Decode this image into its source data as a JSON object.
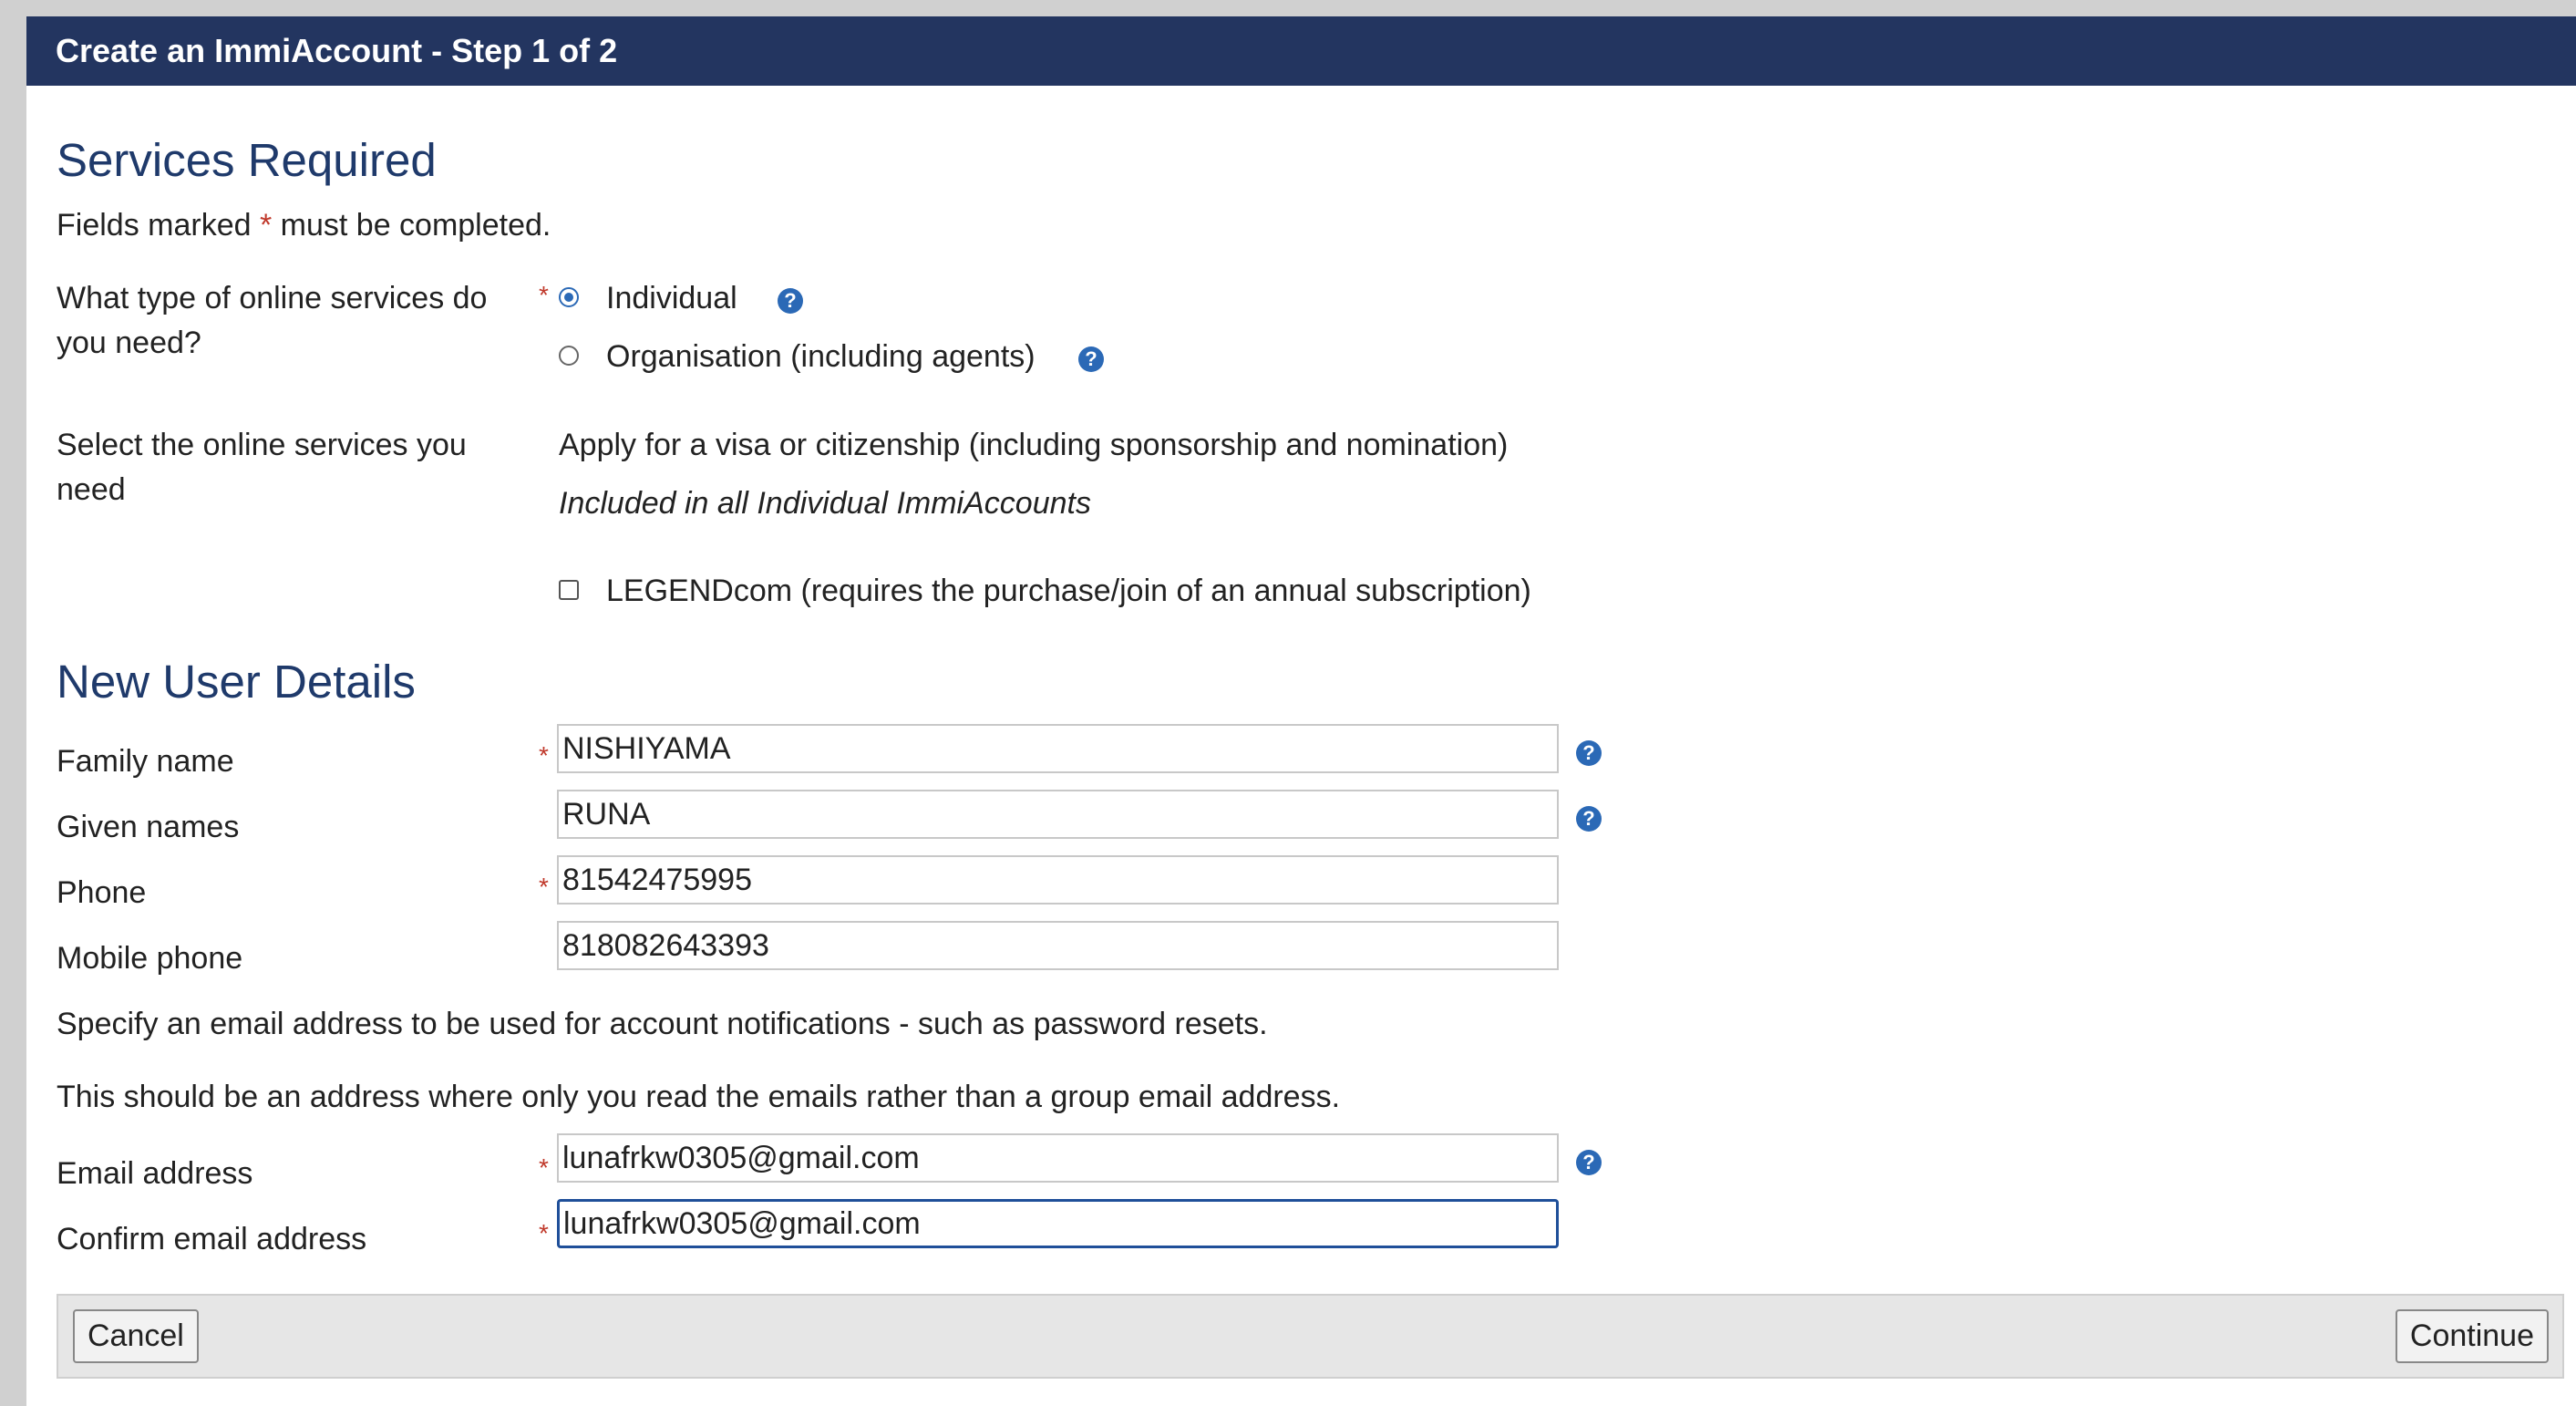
{
  "header": {
    "title": "Create an ImmiAccount - Step 1 of 2"
  },
  "services": {
    "title": "Services Required",
    "required_note_before": "Fields marked",
    "required_note_star": "*",
    "required_note_after": "must be completed.",
    "type_question_line1": "What type of online services do",
    "type_question_line2": "you need?",
    "option_individual": "Individual",
    "option_organisation": "Organisation (including agents)",
    "select_label_line1": "Select the online services you",
    "select_label_line2": "need",
    "visa_service": "Apply for a visa or citizenship (including sponsorship and nomination)",
    "included_note": "Included in all Individual ImmiAccounts",
    "legend_label": "LEGENDcom (requires the purchase/join of an annual subscription)"
  },
  "user": {
    "title": "New User Details",
    "family_name_label": "Family name",
    "family_name_value": "NISHIYAMA",
    "given_names_label": "Given names",
    "given_names_value": "RUNA",
    "phone_label": "Phone",
    "phone_value": "81542475995",
    "mobile_label": "Mobile phone",
    "mobile_value": "818082643393",
    "email_note1": "Specify an email address to be used for account notifications - such as password resets.",
    "email_note2": "This should be an address where only you read the emails rather than a group email address.",
    "email_label": "Email address",
    "email_value": "lunafrkw0305@gmail.com",
    "confirm_email_label": "Confirm email address",
    "confirm_email_value": "lunafrkw0305@gmail.com"
  },
  "actions": {
    "cancel": "Cancel",
    "continue": "Continue"
  },
  "icons": {
    "help": "help-circle-icon",
    "help_glyph": "?"
  },
  "colors": {
    "header_bg": "#233560",
    "title": "#1f3a6b",
    "required": "#c0392b",
    "accent": "#2b69b6"
  }
}
